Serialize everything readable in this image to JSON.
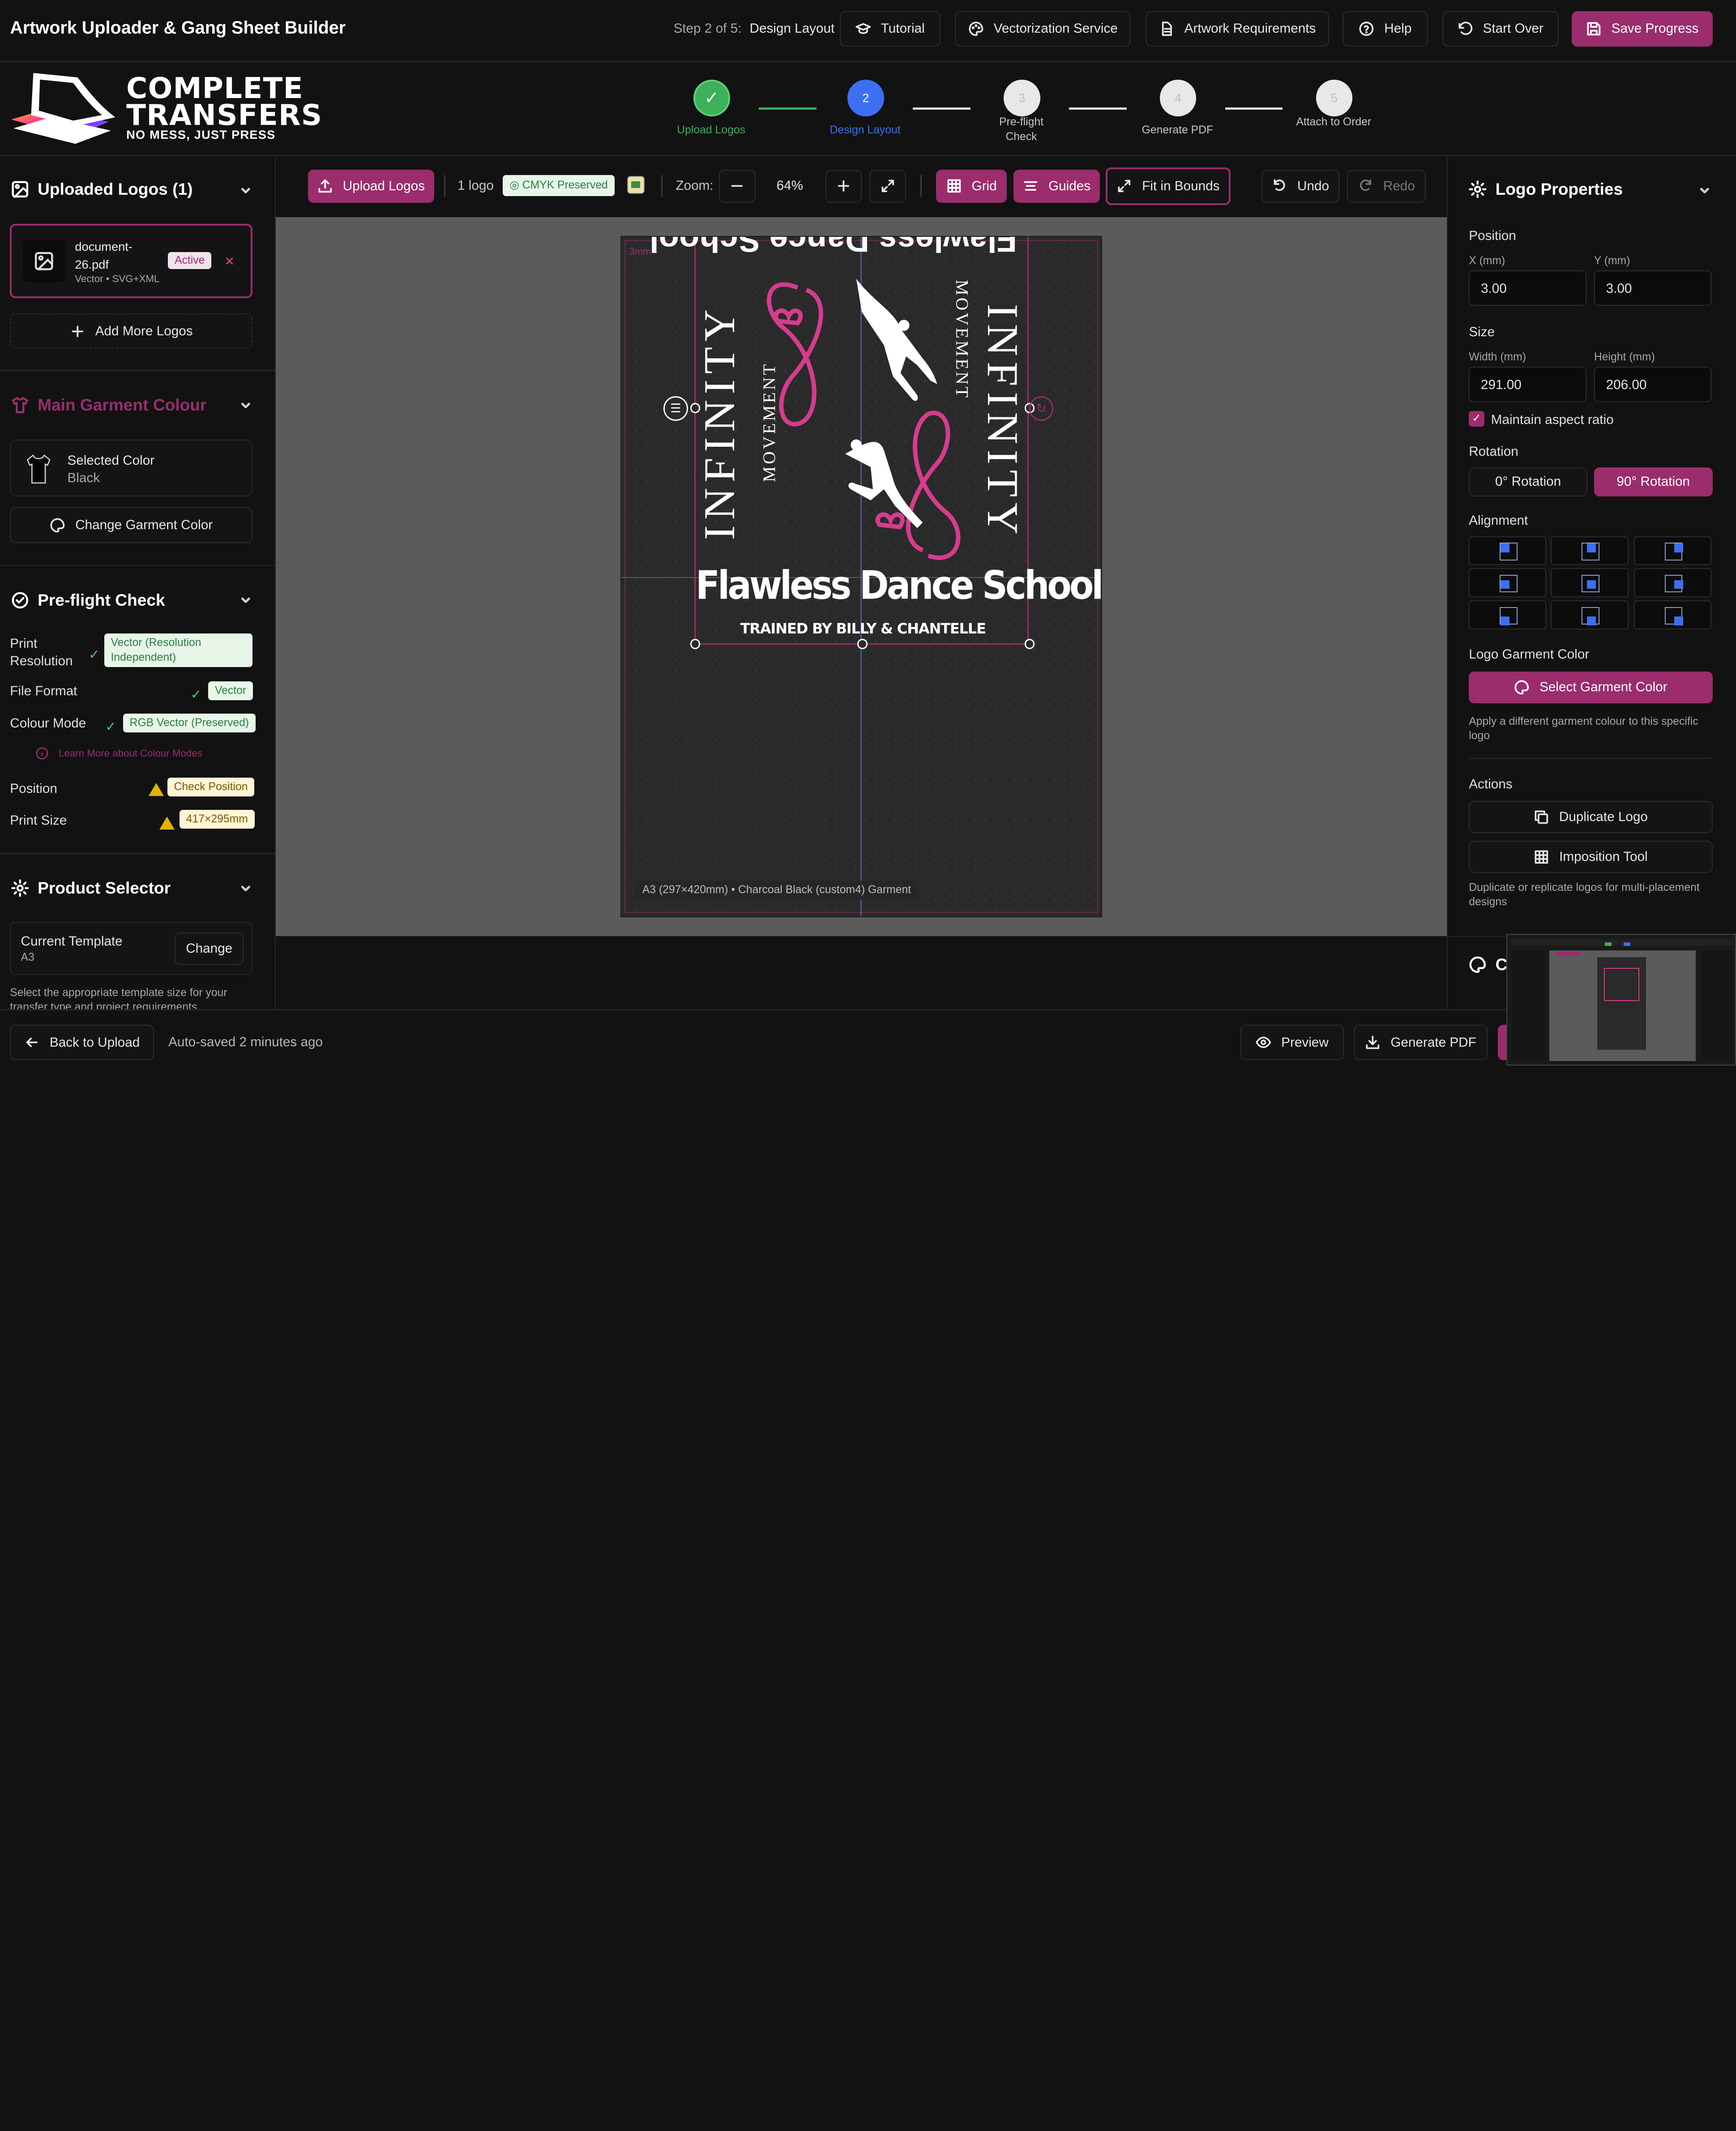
{
  "app": {
    "title": "Artwork Uploader & Gang Sheet Builder",
    "step_prefix": "Step 2 of 5:",
    "step_name": "Design Layout"
  },
  "header_buttons": {
    "tutorial": "Tutorial",
    "vectorization": "Vectorization Service",
    "requirements": "Artwork Requirements",
    "help": "Help",
    "start_over": "Start Over",
    "save": "Save Progress"
  },
  "brand": {
    "line1": "COMPLETE",
    "line2": "TRANSFERS",
    "tagline": "NO MESS, JUST PRESS"
  },
  "stepper": [
    {
      "num": "✓",
      "label": "Upload Logos",
      "state": "done"
    },
    {
      "num": "2",
      "label": "Design Layout",
      "state": "active"
    },
    {
      "num": "3",
      "label": "Pre-flight Check",
      "state": "todo"
    },
    {
      "num": "4",
      "label": "Generate PDF",
      "state": "todo"
    },
    {
      "num": "5",
      "label": "Attach to Order",
      "state": "todo"
    }
  ],
  "uploaded": {
    "title": "Uploaded Logos (1)",
    "file_name": "document-26.pdf",
    "file_meta": "Vector • SVG+XML",
    "active": "Active",
    "add_more": "Add More Logos"
  },
  "garment": {
    "title": "Main Garment Colour",
    "selected_label": "Selected Color",
    "selected_value": "Black",
    "change": "Change Garment Color"
  },
  "preflight": {
    "title": "Pre-flight Check",
    "rows": [
      {
        "label": "Print Resolution",
        "value": "Vector (Resolution Independent)",
        "status": "ok"
      },
      {
        "label": "File Format",
        "value": "Vector",
        "status": "ok"
      },
      {
        "label": "Colour Mode",
        "value": "RGB Vector (Preserved)",
        "status": "ok"
      },
      {
        "label": "Position",
        "value": "Check Position",
        "status": "warn"
      },
      {
        "label": "Print Size",
        "value": "417×295mm",
        "status": "warn"
      }
    ],
    "learn_more": "Learn More about Colour Modes"
  },
  "product": {
    "title": "Product Selector",
    "template_label": "Current Template",
    "template_value": "A3",
    "change": "Change",
    "help": "Select the appropriate template size for your transfer type and project requirements."
  },
  "toolbar": {
    "upload": "Upload Logos",
    "logo_count": "1 logo",
    "cmyk": "CMYK Preserved",
    "zoom_label": "Zoom:",
    "zoom_value": "64%",
    "grid": "Grid",
    "guides": "Guides",
    "fit": "Fit in Bounds",
    "undo": "Undo",
    "redo": "Redo"
  },
  "canvas": {
    "margin_label": "3mm",
    "footer": "A3 (297×420mm) • Charcoal Black (custom4) Garment",
    "artwork": {
      "infinity": "INFINITY",
      "movement": "MOVEMENT",
      "school": "Flawless Dance School",
      "trainer": "TRAINED BY BILLY & CHANTELLE"
    }
  },
  "properties": {
    "title": "Logo Properties",
    "position_label": "Position",
    "x_label": "X (mm)",
    "x_value": "3.00",
    "y_label": "Y (mm)",
    "y_value": "3.00",
    "size_label": "Size",
    "width_label": "Width (mm)",
    "width_value": "291.00",
    "height_label": "Height (mm)",
    "height_value": "206.00",
    "aspect": "Maintain aspect ratio",
    "rotation_label": "Rotation",
    "rot0": "0° Rotation",
    "rot90": "90° Rotation",
    "alignment_label": "Alignment",
    "garment_color_label": "Logo Garment Color",
    "select_color": "Select Garment Color",
    "garment_help": "Apply a different garment colour to this specific logo",
    "actions_label": "Actions",
    "duplicate": "Duplicate Logo",
    "imposition": "Imposition Tool",
    "actions_help": "Duplicate or replicate logos for multi-placement designs",
    "next_section": "C"
  },
  "footer": {
    "back": "Back to Upload",
    "autosave": "Auto-saved 2 minutes ago",
    "preview": "Preview",
    "generate": "Generate PDF"
  },
  "colors": {
    "accent": "#9b2d6c",
    "step_done": "#3cb05a",
    "step_active": "#3d6ff2",
    "artwork_pink": "#d63c8e"
  }
}
